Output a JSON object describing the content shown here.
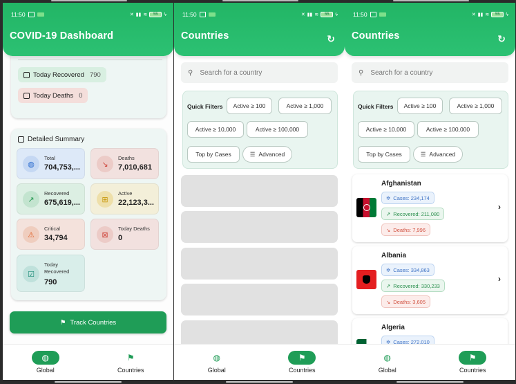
{
  "status": {
    "time": "11:50",
    "battery": "55"
  },
  "nav": {
    "global": "Global",
    "countries": "Countries"
  },
  "dashboard": {
    "title": "COVID-19 Dashboard",
    "today_recovered": {
      "label": "Today Recovered",
      "value": "790"
    },
    "today_deaths": {
      "label": "Today Deaths",
      "value": "0"
    },
    "summary_title": "Detailed Summary",
    "tiles": [
      {
        "label": "Total",
        "value": "704,753,..."
      },
      {
        "label": "Deaths",
        "value": "7,010,681"
      },
      {
        "label": "Recovered",
        "value": "675,619,..."
      },
      {
        "label": "Active",
        "value": "22,123,3..."
      },
      {
        "label": "Critical",
        "value": "34,794"
      },
      {
        "label": "Today Deaths",
        "value": "0"
      },
      {
        "label": "Today Recovered",
        "value": "790"
      }
    ],
    "track_button": "Track Countries"
  },
  "countries": {
    "title": "Countries",
    "search_placeholder": "Search for a country",
    "quick_filters": "Quick Filters",
    "filters": [
      "Active ≥ 100",
      "Active ≥ 1,000",
      "Active ≥ 10,000",
      "Active ≥ 100,000",
      "Top by Cases",
      "Advanced"
    ],
    "list": [
      {
        "name": "Afghanistan",
        "cases": "Cases: 234,174",
        "recovered": "Recovered: 211,080",
        "deaths": "Deaths: 7,996"
      },
      {
        "name": "Albania",
        "cases": "Cases: 334,863",
        "recovered": "Recovered: 330,233",
        "deaths": "Deaths: 3,605"
      },
      {
        "name": "Algeria",
        "cases": "Cases: 272,010"
      }
    ]
  },
  "colors": {
    "primary": "#22b565",
    "accent_dark": "#1f9d57"
  }
}
